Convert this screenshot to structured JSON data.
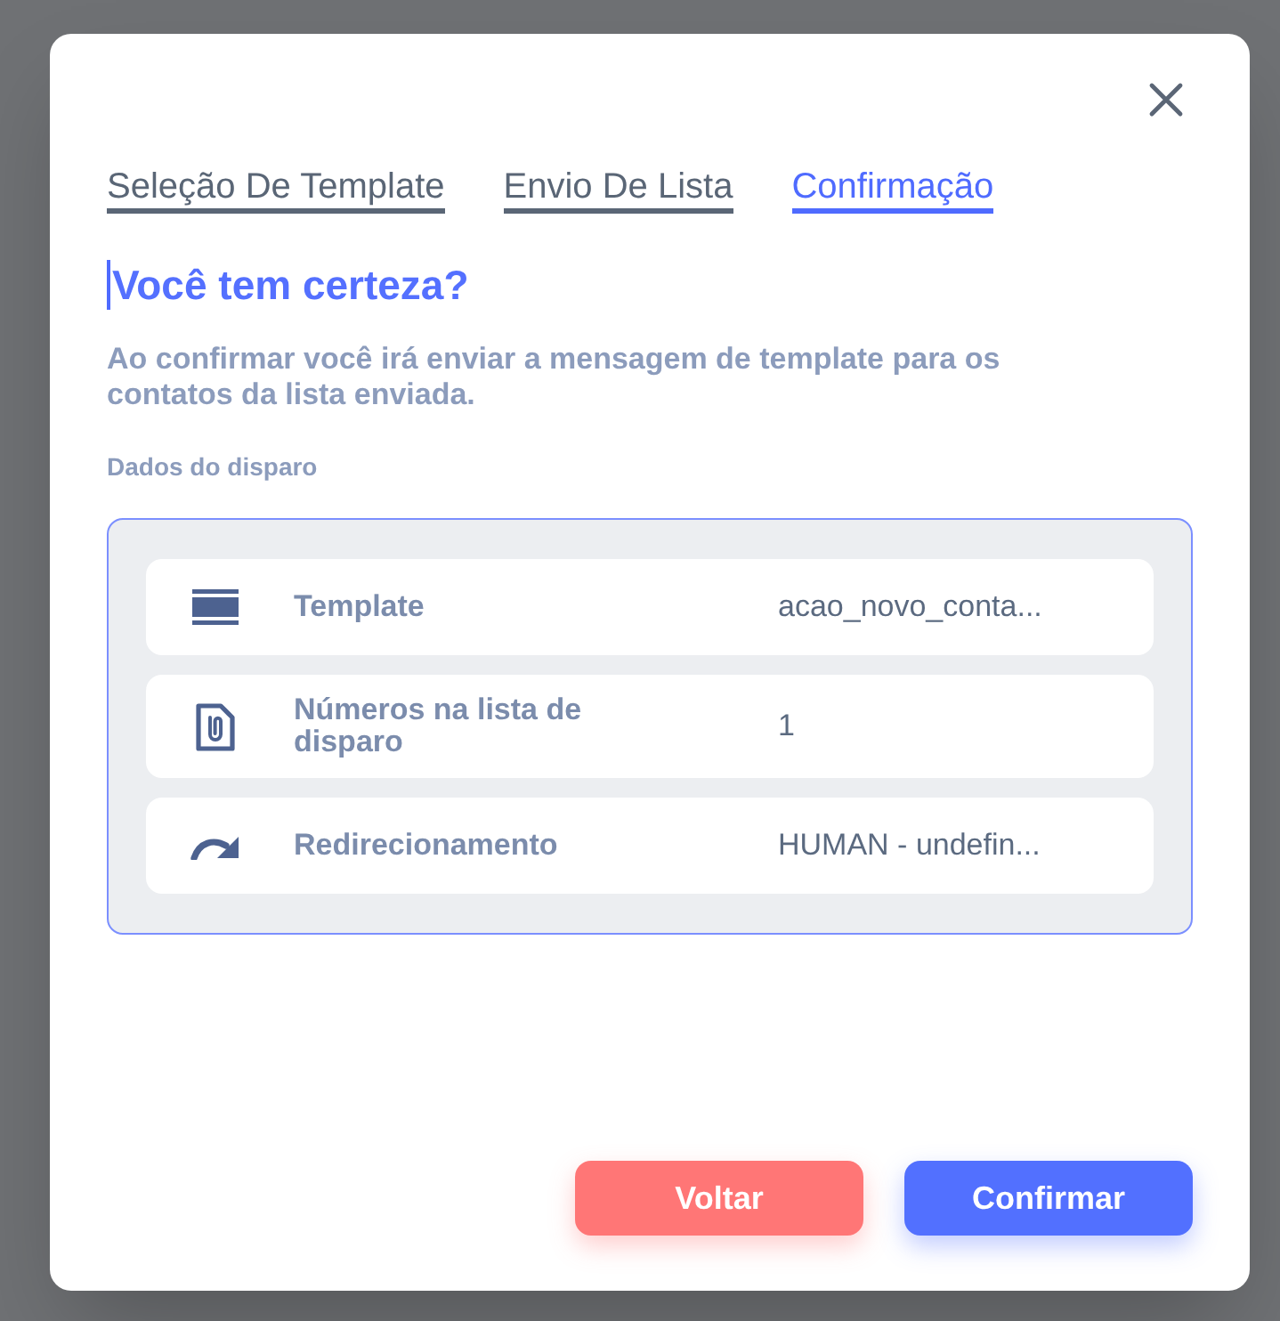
{
  "tabs": [
    {
      "label": "Seleção De Template",
      "selected": false
    },
    {
      "label": "Envio De Lista",
      "selected": false
    },
    {
      "label": "Confirmação",
      "selected": true
    }
  ],
  "heading": {
    "text": "Você tem certeza?",
    "caret": true
  },
  "description": "Ao confirmar você irá enviar a mensagem de template para os contatos da lista enviada.",
  "section_label": "Dados do disparo",
  "details": [
    {
      "kind": "template",
      "label": "Template",
      "value": "acao_novo_conta..."
    },
    {
      "kind": "file",
      "label": "Números na lista de disparo",
      "value": "1"
    },
    {
      "kind": "redirect",
      "label": "Redirecionamento",
      "value": "HUMAN - undefin..."
    }
  ],
  "buttons": [
    {
      "kind": "secondary",
      "label": "Voltar"
    },
    {
      "kind": "primary",
      "label": "Confirmar"
    }
  ]
}
